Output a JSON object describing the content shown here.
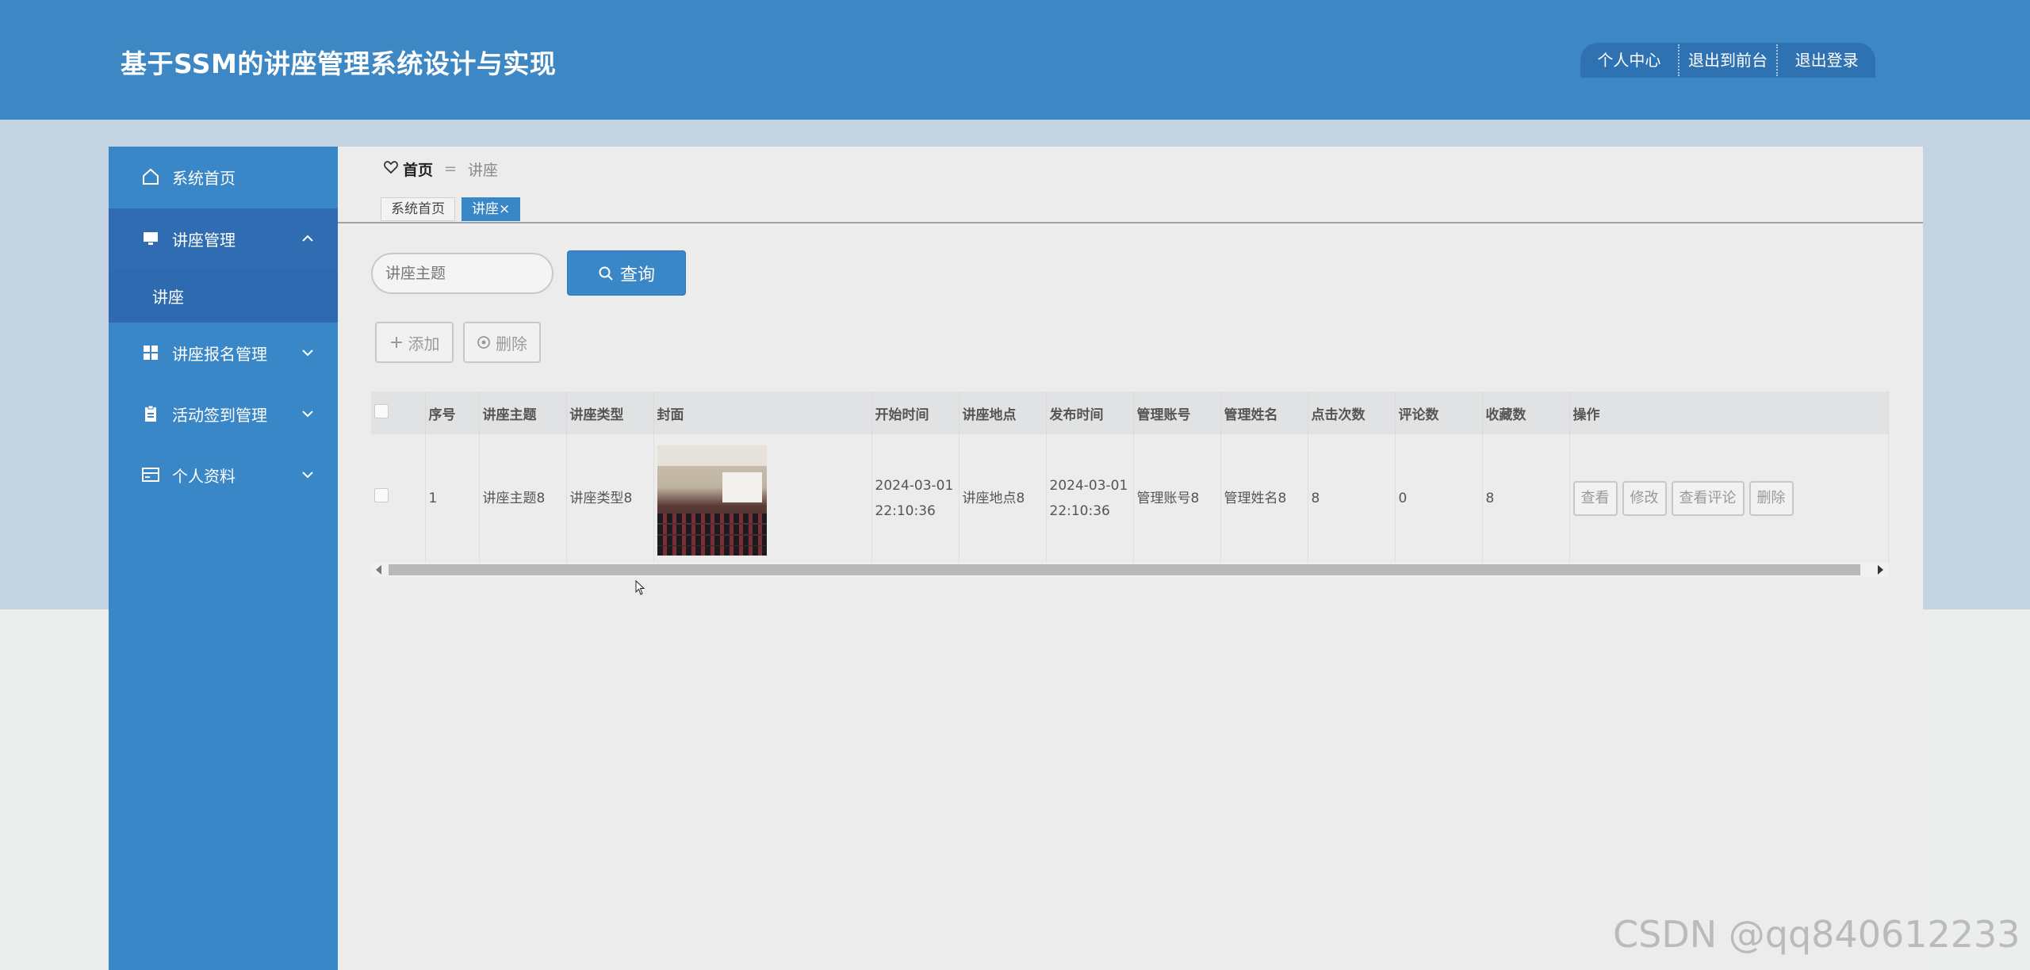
{
  "header": {
    "title": "基于SSM的讲座管理系统设计与实现",
    "nav": [
      "个人中心",
      "退出到前台",
      "退出登录"
    ]
  },
  "sidebar": {
    "items": [
      {
        "label": "系统首页",
        "icon": "home-icon"
      },
      {
        "label": "讲座管理",
        "icon": "monitor-icon",
        "expanded": true
      },
      {
        "label": "讲座报名管理",
        "icon": "grid-icon"
      },
      {
        "label": "活动签到管理",
        "icon": "clipboard-icon"
      },
      {
        "label": "个人资料",
        "icon": "card-icon"
      }
    ],
    "sub_item": "讲座"
  },
  "breadcrumb": {
    "home": "首页",
    "separator": "=",
    "current": "讲座"
  },
  "tabs": [
    {
      "label": "系统首页",
      "active": false
    },
    {
      "label": "讲座×",
      "active": true
    }
  ],
  "search": {
    "placeholder": "讲座主题",
    "button_label": "查询"
  },
  "toolbar": {
    "add_label": "添加",
    "delete_label": "删除"
  },
  "table": {
    "columns": [
      "序号",
      "讲座主题",
      "讲座类型",
      "封面",
      "开始时间",
      "讲座地点",
      "发布时间",
      "管理账号",
      "管理姓名",
      "点击次数",
      "评论数",
      "收藏数",
      "操作"
    ],
    "rows": [
      {
        "index": "1",
        "topic": "讲座主题8",
        "type": "讲座类型8",
        "start_date": "2024-03-01",
        "start_time": "22:10:36",
        "location": "讲座地点8",
        "publish_date": "2024-03-01",
        "publish_time": "22:10:36",
        "admin_account": "管理账号8",
        "admin_name": "管理姓名8",
        "clicks": "8",
        "comments": "0",
        "favorites": "8",
        "actions": [
          "查看",
          "修改",
          "查看评论",
          "删除"
        ]
      }
    ]
  },
  "watermark": "CSDN @qq840612233",
  "colors": {
    "header": "#3d87c4",
    "sidebar": "#3a87c8",
    "accent": "#3a87c8",
    "band": "#c4d3e1"
  }
}
